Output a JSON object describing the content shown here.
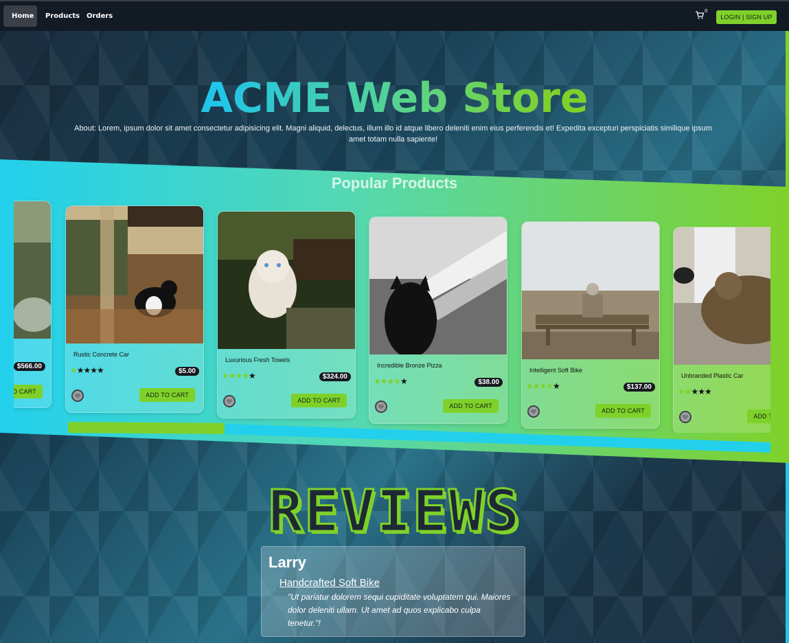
{
  "nav": {
    "items": [
      {
        "label": "Home",
        "active": true
      },
      {
        "label": "Products",
        "active": false
      },
      {
        "label": "Orders",
        "active": false
      }
    ],
    "cart_icon": "cart-icon",
    "cart_count": "0",
    "login_label": "LOGIN | SIGN UP"
  },
  "hero": {
    "title": "ACME Web Store",
    "about": "About: Lorem, ipsum dolor sit amet consectetur adipisicing elit. Magni aliquid, delectus, illum illo id atque libero deleniti enim eius perferendis et! Expedita excepturi perspiciatis similique ipsum amet totam nulla sapiente!"
  },
  "popular": {
    "title": "Popular Products",
    "add_label": "ADD TO CART",
    "products": [
      {
        "name": "",
        "price": "$566.00",
        "rating": 0
      },
      {
        "name": "Rustic Concrete Car",
        "price": "$5.00",
        "rating": 1
      },
      {
        "name": "Luxurious Fresh Towels",
        "price": "$324.00",
        "rating": 4
      },
      {
        "name": "Incredible Bronze Pizza",
        "price": "$38.00",
        "rating": 4
      },
      {
        "name": "Intelligent Soft Bike",
        "price": "$137.00",
        "rating": 4
      },
      {
        "name": "Unbranded Plastic Car",
        "price": "",
        "rating": 2
      }
    ]
  },
  "reviews": {
    "title": "REVIEWS",
    "items": [
      {
        "author": "Larry",
        "product": "Handcrafted Soft Bike",
        "text": "\"Ut pariatur dolorem sequi cupiditate voluptatem qui. Maiores dolor deleniti ullam. Ut amet ad quos explicabo culpa tenetur.\"!"
      }
    ]
  },
  "colors": {
    "accent_green": "#7fd12a",
    "accent_cyan": "#22c5e8",
    "nav_bg": "#121a24"
  }
}
